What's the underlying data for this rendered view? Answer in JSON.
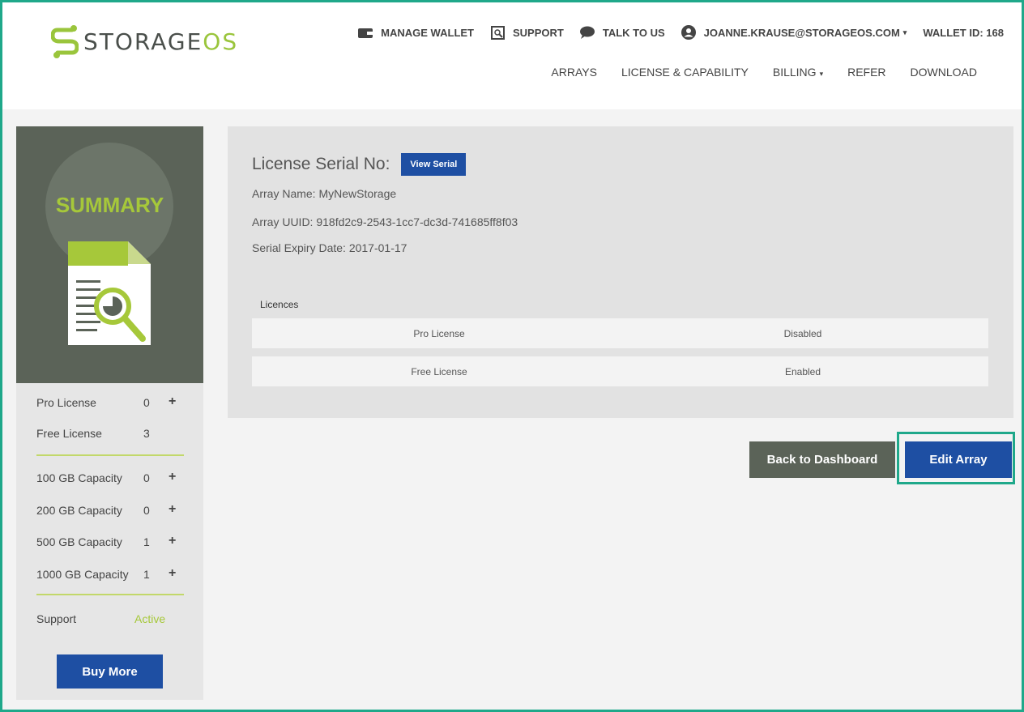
{
  "brand": {
    "logo_storage": "STORAGE",
    "logo_os": "OS"
  },
  "topbar": {
    "manage_wallet": "MANAGE WALLET",
    "support": "SUPPORT",
    "talk_to_us": "TALK TO US",
    "user_email": "JOANNE.KRAUSE@STORAGEOS.COM",
    "wallet_id": "WALLET ID: 168"
  },
  "nav": {
    "arrays": "ARRAYS",
    "license_capability": "LICENSE & CAPABILITY",
    "billing": "BILLING",
    "refer": "REFER",
    "download": "DOWNLOAD"
  },
  "summary": {
    "title": "SUMMARY",
    "rows": [
      {
        "label": "Pro License",
        "value": "0",
        "plus": "+"
      },
      {
        "label": "Free License",
        "value": "3",
        "plus": ""
      },
      {
        "label": "100 GB Capacity",
        "value": "0",
        "plus": "+"
      },
      {
        "label": "200 GB Capacity",
        "value": "0",
        "plus": "+"
      },
      {
        "label": "500 GB Capacity",
        "value": "1",
        "plus": "+"
      },
      {
        "label": "1000 GB Capacity",
        "value": "1",
        "plus": "+"
      }
    ],
    "support_label": "Support",
    "support_status": "Active",
    "buy_more": "Buy More"
  },
  "details": {
    "serial_label": "License Serial No:",
    "view_serial": "View Serial",
    "array_name": "Array Name: MyNewStorage",
    "array_uuid": "Array UUID: 918fd2c9-2543-1cc7-dc3d-741685ff8f03",
    "expiry": "Serial Expiry Date: 2017-01-17",
    "licences_title": "Licences",
    "licences": [
      {
        "name": "Pro License",
        "status": "Disabled"
      },
      {
        "name": "Free License",
        "status": "Enabled"
      }
    ]
  },
  "actions": {
    "back": "Back to Dashboard",
    "edit": "Edit Array"
  },
  "colors": {
    "accent_green": "#a6c83a",
    "primary_blue": "#1e4fa3",
    "dark_gray": "#5b6358",
    "highlight": "#1fa88a"
  }
}
